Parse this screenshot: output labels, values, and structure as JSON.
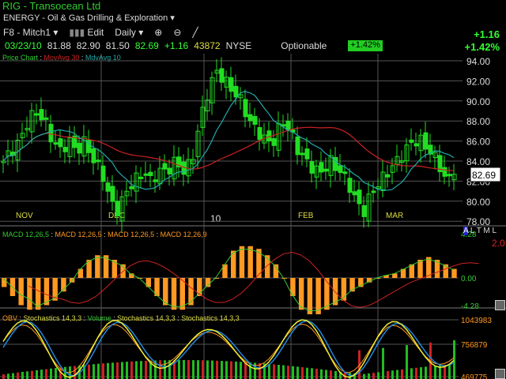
{
  "header": {
    "title": "RIG - Transocean Ltd",
    "sector": "ENERGY - Oil & Gas Drilling & Exploration",
    "layout": "F8 - Mitch1",
    "edit": "Edit",
    "period": "Daily",
    "change": "+1.16",
    "change_pct": "+1.42%"
  },
  "quote": {
    "date": "03/23/10",
    "open": "81.88",
    "high": "82.90",
    "low": "81.50",
    "close": "82.69",
    "change": "+1.16",
    "volume": "43872",
    "exchange": "NYSE",
    "optionable": "Optionable",
    "pct_badge": "+1.42%"
  },
  "legends": {
    "price": [
      "Price Chart",
      "MovAvg 30",
      "MdvAvg 10"
    ],
    "macd": [
      "MACD 12,26,5",
      "MACD 12,26,5",
      "MACD 12,26,5",
      "MACD 12,26,9"
    ],
    "osc": [
      "OBV",
      "Stochastics 14,3,3",
      "Volume",
      "Stochastics 14,3,3",
      "Stochastics 14,3,3"
    ]
  },
  "side": {
    "a": "A",
    "ltml": "L T M L",
    "ratio": "2.0"
  },
  "colors": {
    "up": "#22dd22",
    "ma30": "#cc2222",
    "ma10": "#22aaaa",
    "macd_hist": "#ff9922"
  },
  "chart_data": [
    {
      "type": "candlestick",
      "title": "Price Chart",
      "yticks": [
        "94.00",
        "92.00",
        "90.00",
        "88.00",
        "86.00",
        "84.00",
        "82.00",
        "80.00",
        "78.00"
      ],
      "ylim": [
        77.5,
        95
      ],
      "last_label": "82.69",
      "months": [
        "NOV",
        "DEC",
        "10",
        "FEB",
        "MAR"
      ],
      "price_path": [
        84,
        85,
        86,
        88,
        89,
        88,
        86,
        85,
        86,
        85,
        86,
        84,
        83,
        80,
        79,
        81,
        82,
        83,
        82,
        83,
        83,
        84,
        83,
        84,
        88,
        91,
        93,
        92,
        91,
        90,
        88,
        87,
        86,
        86,
        88,
        87,
        85,
        84,
        83,
        83,
        84,
        83,
        82,
        80,
        79,
        81,
        82,
        83,
        84,
        85,
        86,
        86,
        85,
        84,
        82,
        82.69
      ]
    },
    {
      "type": "bar",
      "title": "MACD",
      "yticks": [
        "4.28",
        "0.00",
        "-4.28"
      ],
      "hist": [
        -1,
        -2,
        -3,
        -3.5,
        -3.5,
        -3,
        -2.5,
        -1.5,
        -0.5,
        1,
        2,
        2.5,
        2.5,
        2,
        1.5,
        0.5,
        0,
        -1,
        -2,
        -3,
        -3.5,
        -3.5,
        -3,
        -2,
        -1,
        0,
        1.5,
        3,
        3.5,
        3.5,
        3.2,
        2.5,
        1.5,
        0,
        -2,
        -3.5,
        -4,
        -4,
        -3.5,
        -3,
        -2.5,
        -1.5,
        -1,
        -0.5,
        0,
        0.3,
        0.5,
        1,
        1.5,
        2,
        2.3,
        2,
        1.5,
        1
      ]
    },
    {
      "type": "line",
      "title": "OBV / Stochastics / Volume",
      "yticks": [
        "1043983",
        "756879",
        "469775"
      ]
    }
  ]
}
